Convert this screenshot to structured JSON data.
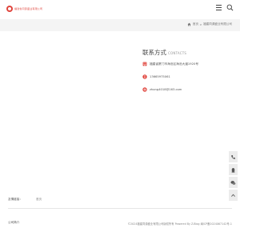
{
  "header": {
    "logo_text": "福建省同源盛业有限公司",
    "menu_icon": "hamburger-menu-icon",
    "search_icon": "search-icon"
  },
  "breadcrumb": {
    "home_icon": "home-icon",
    "home": "首页",
    "separator": ">",
    "current": "福建同源盛业有限公司"
  },
  "contact": {
    "title": "联系方式",
    "subtitle": "CONTACTS",
    "address": "福建省厦门市海沧区海沧大道1920号",
    "phone": "13665975061",
    "email": "zhong4018@163.com",
    "accent_color": "#e0453d"
  },
  "side_tools": [
    "phone-icon",
    "qq-icon",
    "wechat-icon",
    "back-to-top-icon"
  ],
  "footer": {
    "links_label": "友情链接：",
    "links": [
      "首页"
    ],
    "company": "公司简介",
    "copyright": "©2024福建同源盛业有限公司版权所有 Powered By Z-Blog 闽ICP备2024067142号-1"
  }
}
